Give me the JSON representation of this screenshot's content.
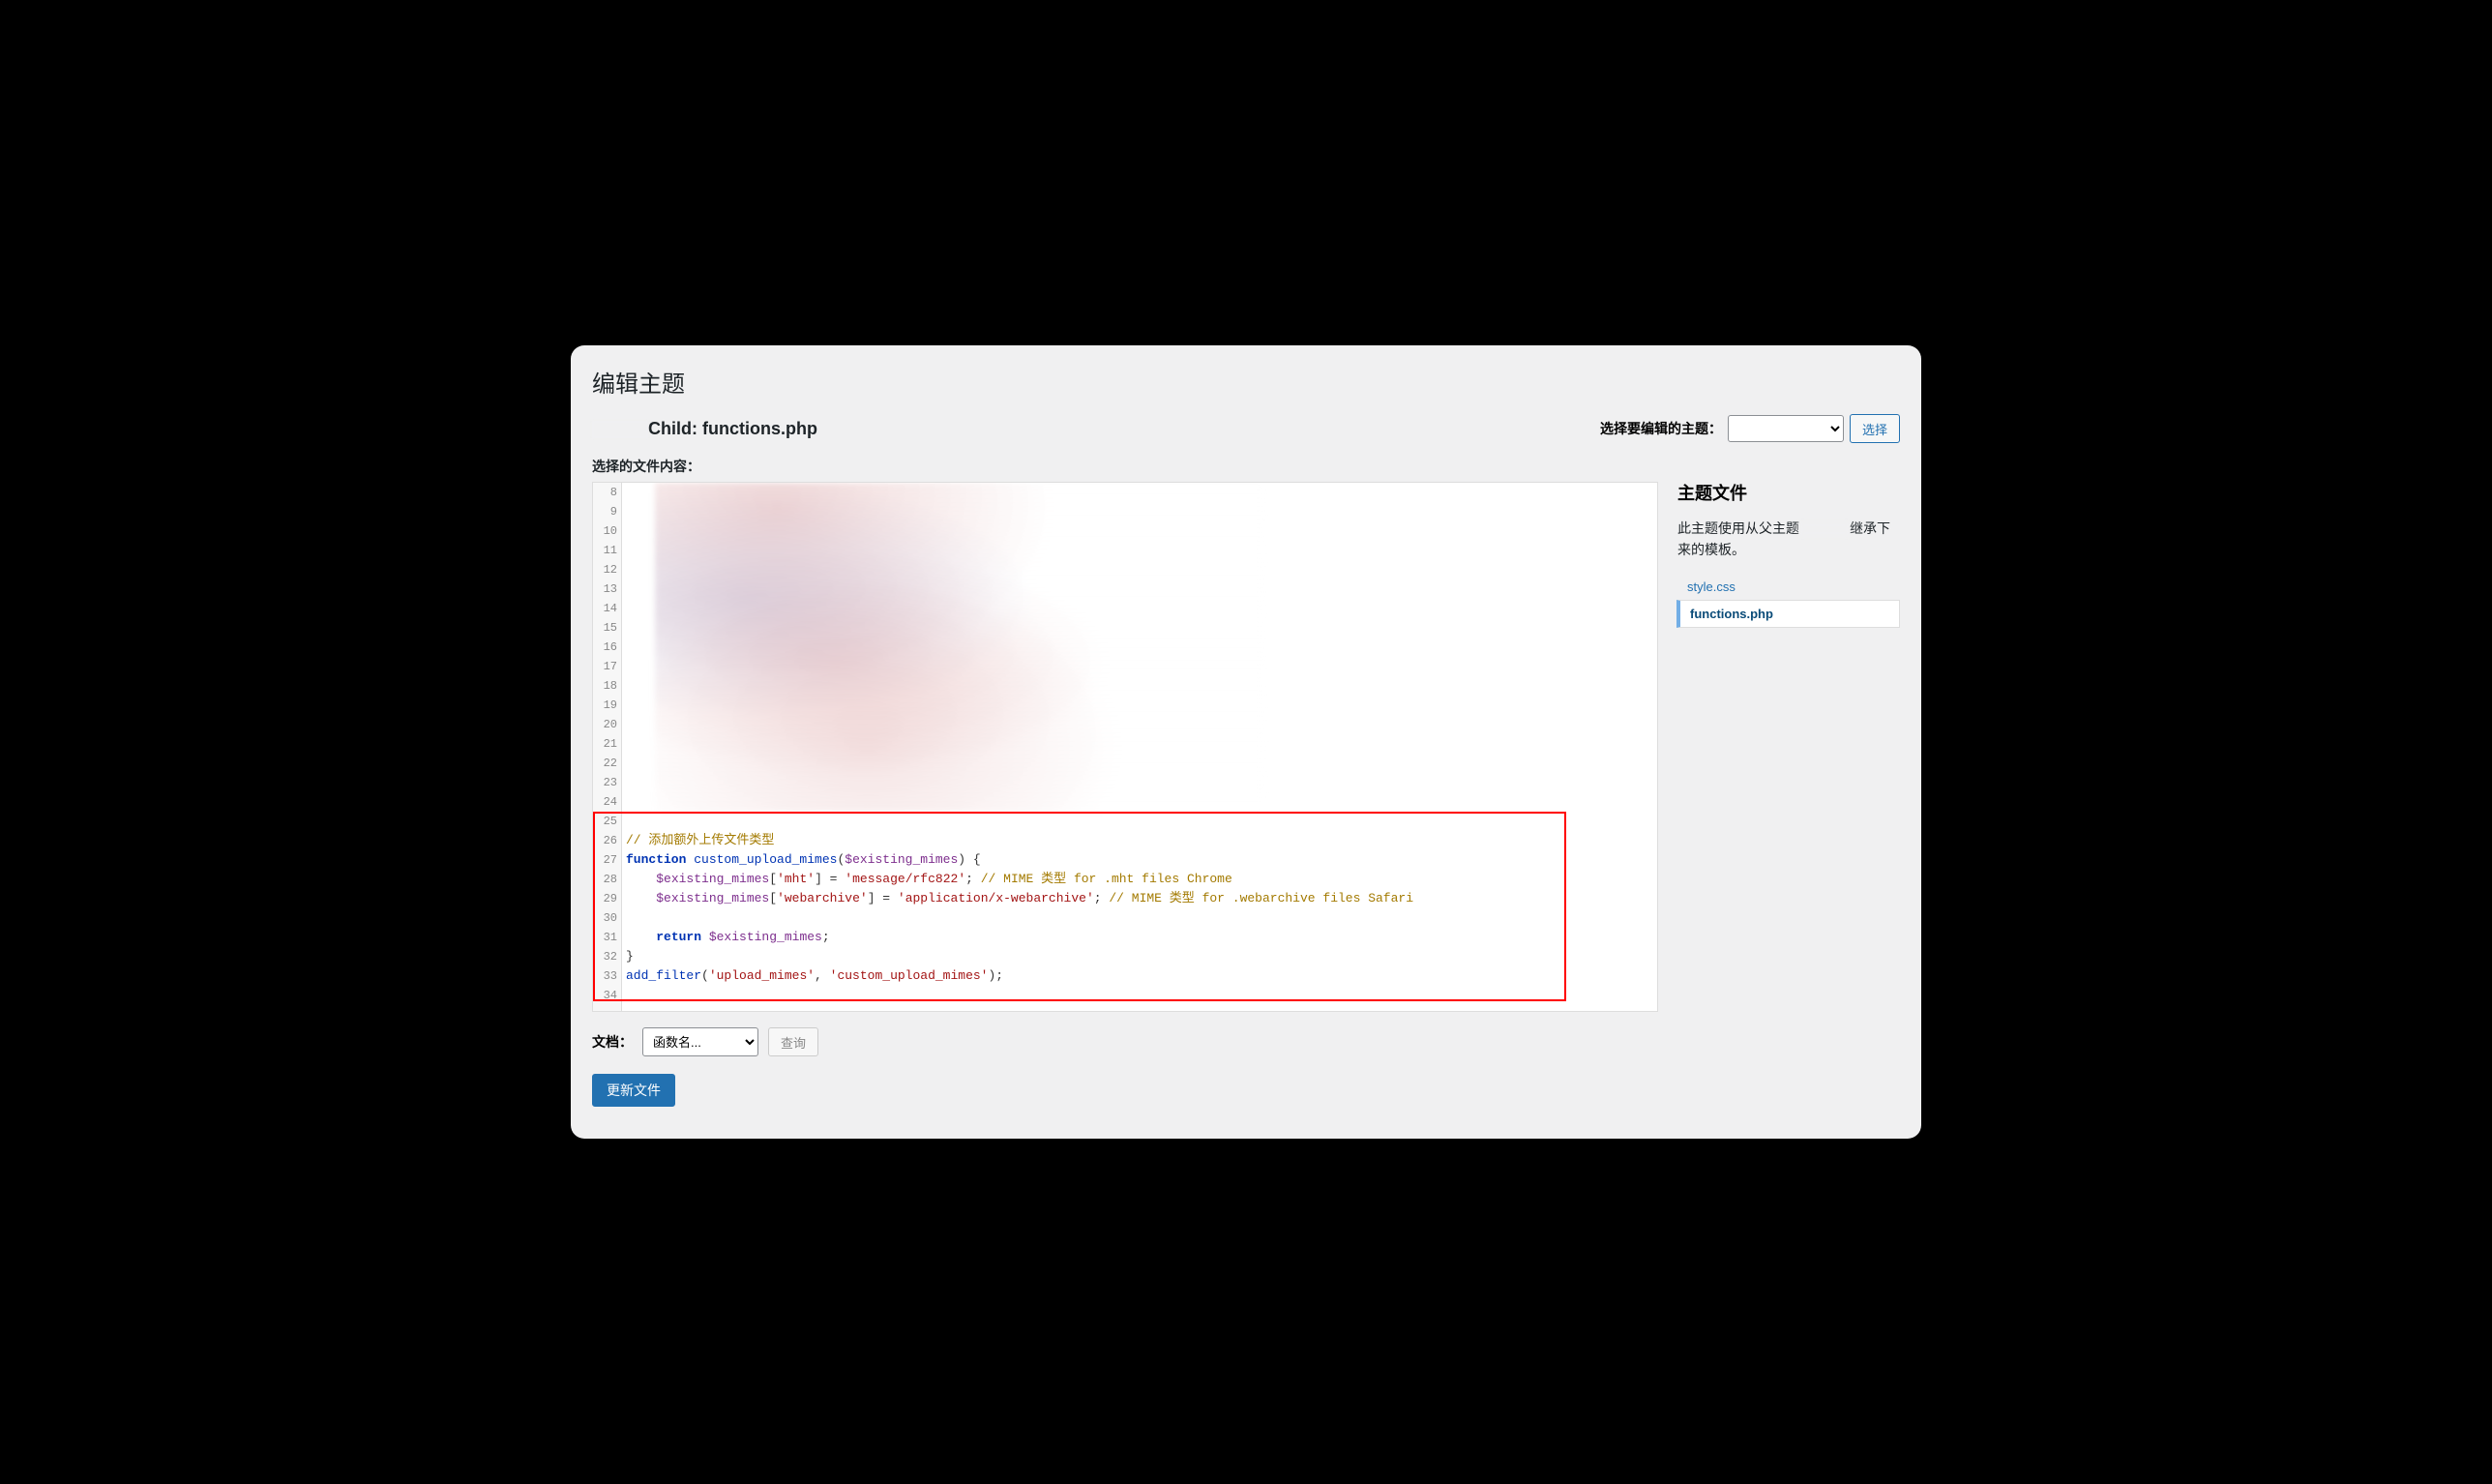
{
  "page_title": "编辑主题",
  "theme_file_heading": "Child: functions.php",
  "theme_select_label": "选择要编辑的主题：",
  "theme_select_button": "选择",
  "content_label": "选择的文件内容：",
  "sidebar": {
    "title": "主题文件",
    "note_prefix": "此主题使用从父主题",
    "note_suffix": "继承下来的模板。",
    "files": [
      {
        "name": "style.css",
        "active": false
      },
      {
        "name": "functions.php",
        "active": true
      }
    ]
  },
  "editor": {
    "first_line_number": 8,
    "last_line_number": 34,
    "visible_code_start_line": 25,
    "lines": [
      {
        "n": 25,
        "segments": []
      },
      {
        "n": 26,
        "segments": [
          {
            "t": "// 添加额外上传文件类型",
            "c": "tok-comment"
          }
        ]
      },
      {
        "n": 27,
        "segments": [
          {
            "t": "function ",
            "c": "tok-keyword"
          },
          {
            "t": "custom_upload_mimes",
            "c": "tok-func"
          },
          {
            "t": "(",
            "c": "tok-brace"
          },
          {
            "t": "$existing_mimes",
            "c": "tok-var"
          },
          {
            "t": ") {",
            "c": "tok-brace"
          }
        ]
      },
      {
        "n": 28,
        "segments": [
          {
            "t": "    ",
            "c": ""
          },
          {
            "t": "$existing_mimes",
            "c": "tok-var"
          },
          {
            "t": "[",
            "c": "tok-brace"
          },
          {
            "t": "'mht'",
            "c": "tok-string"
          },
          {
            "t": "] = ",
            "c": "tok-brace"
          },
          {
            "t": "'message/rfc822'",
            "c": "tok-string"
          },
          {
            "t": "; ",
            "c": "tok-brace"
          },
          {
            "t": "// MIME 类型 for .mht files Chrome",
            "c": "tok-comment"
          }
        ]
      },
      {
        "n": 29,
        "segments": [
          {
            "t": "    ",
            "c": ""
          },
          {
            "t": "$existing_mimes",
            "c": "tok-var"
          },
          {
            "t": "[",
            "c": "tok-brace"
          },
          {
            "t": "'webarchive'",
            "c": "tok-string"
          },
          {
            "t": "] = ",
            "c": "tok-brace"
          },
          {
            "t": "'application/x-webarchive'",
            "c": "tok-string"
          },
          {
            "t": "; ",
            "c": "tok-brace"
          },
          {
            "t": "// MIME 类型 for .webarchive files Safari",
            "c": "tok-comment"
          }
        ]
      },
      {
        "n": 30,
        "segments": []
      },
      {
        "n": 31,
        "segments": [
          {
            "t": "    ",
            "c": ""
          },
          {
            "t": "return ",
            "c": "tok-return"
          },
          {
            "t": "$existing_mimes",
            "c": "tok-var"
          },
          {
            "t": ";",
            "c": "tok-brace"
          }
        ]
      },
      {
        "n": 32,
        "segments": [
          {
            "t": "}",
            "c": "tok-brace"
          }
        ]
      },
      {
        "n": 33,
        "segments": [
          {
            "t": "add_filter",
            "c": "tok-func"
          },
          {
            "t": "(",
            "c": "tok-brace"
          },
          {
            "t": "'upload_mimes'",
            "c": "tok-string"
          },
          {
            "t": ", ",
            "c": "tok-brace"
          },
          {
            "t": "'custom_upload_mimes'",
            "c": "tok-string"
          },
          {
            "t": ");",
            "c": "tok-brace"
          }
        ]
      },
      {
        "n": 34,
        "segments": []
      }
    ]
  },
  "lookup": {
    "label": "文档：",
    "select_placeholder": "函数名...",
    "button": "查询"
  },
  "update_button": "更新文件"
}
